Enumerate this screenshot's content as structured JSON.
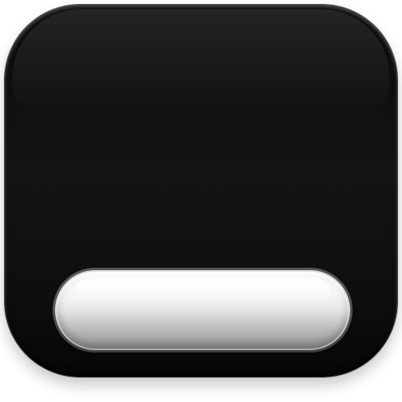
{
  "app_icon": {
    "icon_name": "app-icon",
    "background_color": "#111111",
    "accent_color": "#ffffff"
  },
  "bottom_bar": {
    "icon_name": "bottom-bar-icon",
    "color": "#e9e9e9"
  }
}
